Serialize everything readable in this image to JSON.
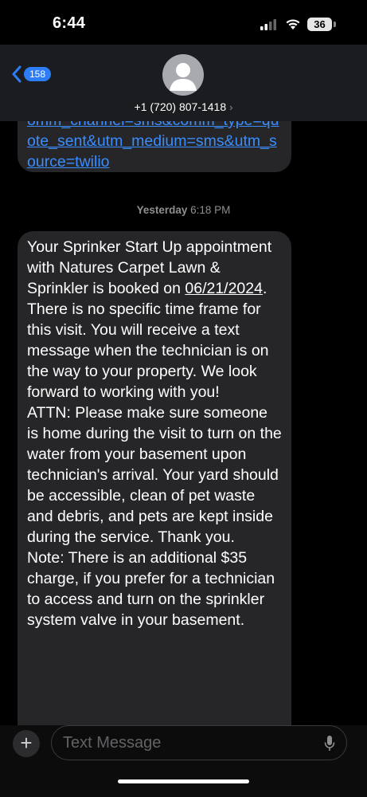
{
  "status_bar": {
    "time": "6:44",
    "battery": "36"
  },
  "header": {
    "back_count": "158",
    "contact": "+1 (720) 807-1418"
  },
  "messages": {
    "prev_link": "omm_channel=sms&comm_type=quote_sent&utm_medium=sms&utm_source=twilio",
    "timestamp_day": "Yesterday",
    "timestamp_time": "6:18 PM",
    "body_before_date": "Your Sprinker Start Up appointment with Natures Carpet Lawn & Sprinkler is booked on ",
    "date": "06/21/2024",
    "body_after_date": ". There is no specific time frame for this visit. You will receive a text message when the technician is on the way to your property. We look forward to working with you!",
    "attn": "ATTN: Please make sure someone is home during the visit to turn on the water from your basement upon technician's arrival. Your yard should be accessible, clean of pet waste and debris, and pets are kept inside during the service. Thank you.",
    "note": "Note: There is an additional $35 charge, if you prefer for a technician to access and turn on the sprinkler system valve in your basement."
  },
  "input": {
    "placeholder": "Text Message"
  },
  "colors": {
    "link": "#3a8dff",
    "badge": "#2d7df6",
    "bubble": "#262629"
  }
}
